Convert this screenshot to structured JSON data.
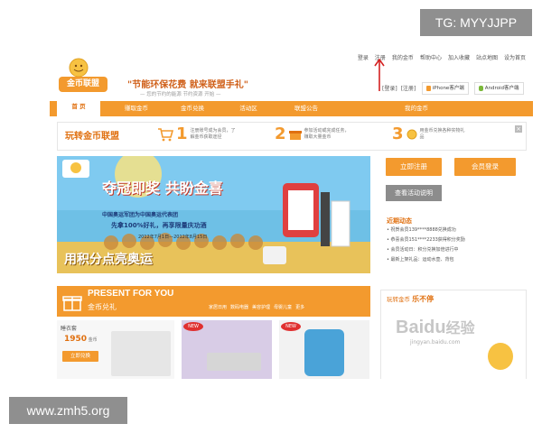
{
  "overlays": {
    "tag": "TG: MYYJJPP",
    "site": "www.zmh5.org"
  },
  "header": {
    "top_links": [
      "登录",
      "注册",
      "我的金币",
      "帮助中心",
      "加入收藏",
      "站点地图",
      "设为首页"
    ],
    "logo_text": "金币联盟",
    "slogan": "\"节能环保花费  就来联盟手礼\"",
    "slogan_sub": "— 您的节约的能源 节约资源 开始 —",
    "login_links": [
      "[登录]",
      "[注册]"
    ],
    "app_iphone": "iPhone客户端",
    "app_android": "Android客户端"
  },
  "nav": {
    "items": [
      "首 页",
      "赚取金币",
      "金币兑换",
      "活动区",
      "联盟公告",
      "我的金币"
    ]
  },
  "steps": {
    "title": "玩转金币联盟",
    "items": [
      {
        "num": "1",
        "text": "注册账号成为会员，了解金币获取途径"
      },
      {
        "num": "2",
        "text": "参加活动或完成任务，赚取大量金币"
      },
      {
        "num": "3",
        "text": "用金币兑换各种实物礼品"
      }
    ]
  },
  "banner": {
    "headline": "夺冠即奖 共盼金喜",
    "line1": "中国奥运军团为中国奥运代表团",
    "line2": "先拿100%好礼，再享限量庆功酒",
    "date": "2012年7月1日—2012年8月15日",
    "bottom": "用积分点亮奥运"
  },
  "sidebar": {
    "register": "立即注册",
    "member_login": "会员登录",
    "gray_btn": "查看活动说明",
    "news_title": "近期动态",
    "news": [
      "• 祝贺会员139****8888兑换成功",
      "• 恭喜会员151****2233获得积分奖励",
      "• 会员活动日：积分兑换加倍进行中",
      "• 最新上架礼品：运动水壶、背包"
    ]
  },
  "present": {
    "title": "PRESENT FOR YOU",
    "subtitle": "金币兑礼",
    "tabs": [
      "家居日用",
      "数码电器",
      "美容护理",
      "母婴儿童",
      "更多"
    ],
    "item_label": "睡衣套",
    "item_price": "1950",
    "item_unit": "金币",
    "exchange_btn": "立即兑换",
    "new_badge": "NEW"
  },
  "right_panel": {
    "title": "玩转金币",
    "highlight": "乐不停",
    "watermark_main": "Baidu",
    "watermark_cn": "经验",
    "watermark_url": "jingyan.baidu.com"
  },
  "colors": {
    "accent": "#f39a2e",
    "accent_dark": "#e07010",
    "banner_sky": "#6ec0e6",
    "arrow": "#d42020"
  }
}
